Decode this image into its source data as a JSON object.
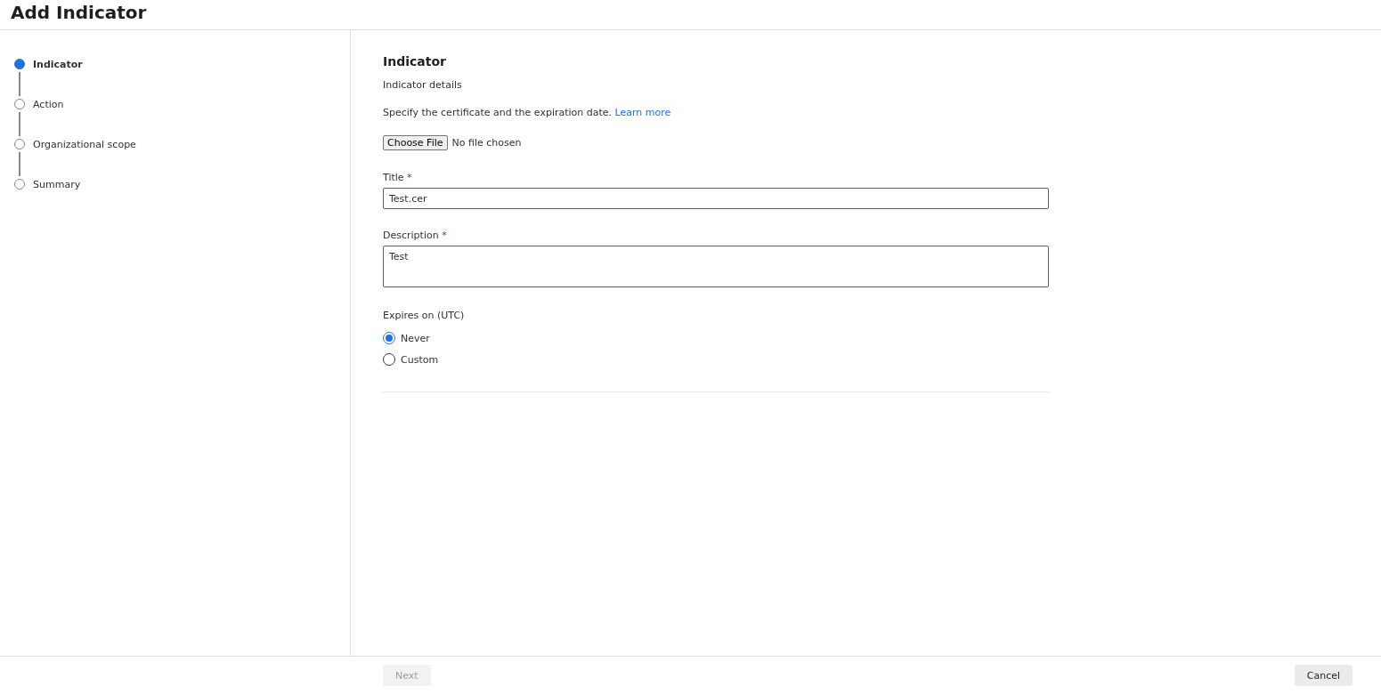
{
  "header": {
    "title": "Add Indicator"
  },
  "steps": [
    {
      "label": "Indicator",
      "selected": true
    },
    {
      "label": "Action",
      "selected": false
    },
    {
      "label": "Organizational scope",
      "selected": false
    },
    {
      "label": "Summary",
      "selected": false
    }
  ],
  "form": {
    "heading": "Indicator",
    "subheading": "Indicator details",
    "instructions": "Specify the certificate and the expiration date.",
    "link": "Learn more",
    "file_picker": {
      "button": "Choose File",
      "status": "No file chosen"
    },
    "fields": [
      {
        "kind": "input",
        "label": "Title",
        "required_mark": "*",
        "value": "Test.cer"
      },
      {
        "kind": "textarea",
        "label": "Description",
        "required_mark": "*",
        "value": "Test"
      }
    ],
    "expires": {
      "label": "Expires on (UTC)",
      "options": [
        {
          "label": "Never",
          "selected": true
        },
        {
          "label": "Custom",
          "selected": false
        }
      ]
    }
  },
  "footer": {
    "buttons": [
      {
        "kind": "next",
        "label": "Next",
        "disabled": true
      },
      {
        "kind": "cancel",
        "label": "Cancel",
        "disabled": false
      }
    ]
  }
}
